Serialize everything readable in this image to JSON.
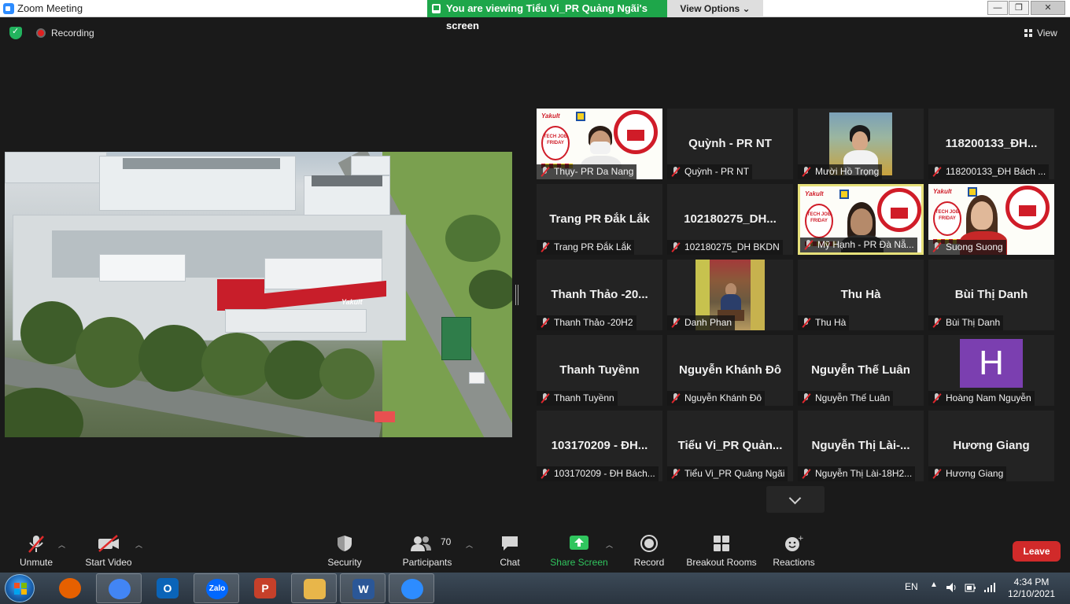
{
  "window": {
    "title": "Zoom Meeting",
    "viewing_banner": "You are viewing Tiểu Vi_PR Quảng Ngãi's screen",
    "view_options": "View Options ⌄",
    "controls": {
      "minimize": "—",
      "restore": "❐",
      "close": "✕"
    }
  },
  "status": {
    "recording": "Recording",
    "view": "View"
  },
  "gallery": {
    "tiles": [
      {
        "big": "",
        "name": "Thụy- PR Da Nang",
        "kind": "poster-mask"
      },
      {
        "big": "Quỳnh - PR NT",
        "name": "Quỳnh - PR NT",
        "kind": "text"
      },
      {
        "big": "",
        "name": "Mười Hồ Trọng",
        "kind": "photo-outdoor"
      },
      {
        "big": "118200133_ĐH...",
        "name": "118200133_ĐH Bách ...",
        "kind": "text"
      },
      {
        "big": "Trang PR Đắk Lắk",
        "name": "Trang PR Đắk Lắk",
        "kind": "text"
      },
      {
        "big": "102180275_DH...",
        "name": "102180275_DH BKDN",
        "kind": "text"
      },
      {
        "big": "",
        "name": "Mỹ Hạnh - PR Đà Nẵ...",
        "kind": "poster-girl",
        "active": true
      },
      {
        "big": "",
        "name": "Suong Suong",
        "kind": "poster-woman"
      },
      {
        "big": "Thanh Thảo -20...",
        "name": "Thanh Thảo -20H2",
        "kind": "text"
      },
      {
        "big": "",
        "name": "Danh Phan",
        "kind": "photo-seated"
      },
      {
        "big": "Thu Hà",
        "name": "Thu Hà",
        "kind": "text"
      },
      {
        "big": "Bùi Thị Danh",
        "name": "Bùi Thị Danh",
        "kind": "text"
      },
      {
        "big": "Thanh Tuyềnn",
        "name": "Thanh Tuyềnn",
        "kind": "text"
      },
      {
        "big": "Nguyễn Khánh Đô",
        "name": "Nguyễn Khánh Đô",
        "kind": "text"
      },
      {
        "big": "Nguyễn Thế Luân",
        "name": "Nguyễn Thế Luân",
        "kind": "text"
      },
      {
        "big": "",
        "name": "Hoàng Nam Nguyễn",
        "kind": "avatar",
        "letter": "H"
      },
      {
        "big": "103170209 - ĐH...",
        "name": "103170209 - ĐH Bách...",
        "kind": "text"
      },
      {
        "big": "Tiểu Vi_PR Quản...",
        "name": "Tiểu Vi_PR Quảng Ngãi",
        "kind": "text"
      },
      {
        "big": "Nguyễn Thị Lài-...",
        "name": "Nguyễn Thị Lài-18H2...",
        "kind": "text"
      },
      {
        "big": "Hương Giang",
        "name": "Hương Giang",
        "kind": "text"
      }
    ]
  },
  "poster_text": {
    "brand": "Yakult",
    "badge": "TECH JOB FRIDAY"
  },
  "shared_screen": {
    "sign": "Yakult"
  },
  "toolbar": {
    "unmute": "Unmute",
    "start_video": "Start Video",
    "security": "Security",
    "participants": "Participants",
    "participants_count": "70",
    "chat": "Chat",
    "share_screen": "Share Screen",
    "record": "Record",
    "breakout_rooms": "Breakout Rooms",
    "reactions": "Reactions",
    "leave": "Leave"
  },
  "taskbar": {
    "apps": [
      {
        "name": "firefox",
        "glyph": "",
        "color": "#e66000",
        "open": false
      },
      {
        "name": "chrome",
        "glyph": "",
        "color": "#4285f4",
        "open": true
      },
      {
        "name": "outlook",
        "glyph": "O",
        "color": "#0a64b8",
        "open": false
      },
      {
        "name": "zalo",
        "glyph": "Zalo",
        "color": "#0068ff",
        "open": true
      },
      {
        "name": "powerpoint",
        "glyph": "P",
        "color": "#c6402a",
        "open": false
      },
      {
        "name": "file-explorer",
        "glyph": "",
        "color": "#e8b64a",
        "open": true
      },
      {
        "name": "word",
        "glyph": "W",
        "color": "#2b5797",
        "open": true
      },
      {
        "name": "zoom",
        "glyph": "",
        "color": "#2d8cff",
        "open": true
      }
    ],
    "language": "EN",
    "time": "4:34 PM",
    "date": "12/10/2021"
  },
  "colors": {
    "share_green": "#30c55e",
    "leave_red": "#d12a2a",
    "active_border": "#e6e07a",
    "avatar_purple": "#7b3fb0"
  }
}
